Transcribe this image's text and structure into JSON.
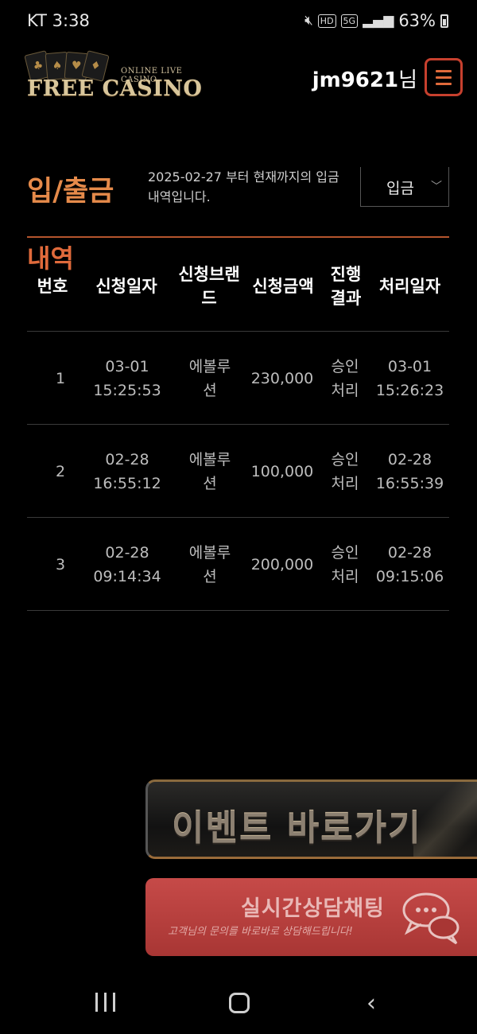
{
  "status_bar": {
    "carrier_time": "KT 3:38",
    "icons": [
      "mute-icon",
      "hd-icon",
      "5g-icon",
      "signal-icon",
      "battery-icon"
    ],
    "hd_label": "HD",
    "network_label": "5G",
    "battery": "63%"
  },
  "header": {
    "logo_sub": "ONLINE LIVE CASINO",
    "logo_main": "FREE CASINO",
    "logo_suits": [
      "♣",
      "♠",
      "♥",
      "♦"
    ],
    "username": "jm9621",
    "username_suffix": "님"
  },
  "page": {
    "title": "입/출금",
    "period_text": "2025-02-27 부터 현재까지의 입금 내역입니다.",
    "type_select": {
      "value": "입금"
    },
    "section_title": "내역"
  },
  "table": {
    "headers": [
      "번호",
      "신청일자",
      "신청브랜드",
      "신청금액",
      "진행결과",
      "처리일자"
    ],
    "rows": [
      {
        "no": "1",
        "req_date": "03-01",
        "req_time": "15:25:53",
        "brand": "에볼루션",
        "amount": "230,000",
        "status": "승인처리",
        "proc_date": "03-01",
        "proc_time": "15:26:23"
      },
      {
        "no": "2",
        "req_date": "02-28",
        "req_time": "16:55:12",
        "brand": "에볼루션",
        "amount": "100,000",
        "status": "승인처리",
        "proc_date": "02-28",
        "proc_time": "16:55:39"
      },
      {
        "no": "3",
        "req_date": "02-28",
        "req_time": "09:14:34",
        "brand": "에볼루션",
        "amount": "200,000",
        "status": "승인처리",
        "proc_date": "02-28",
        "proc_time": "09:15:06"
      }
    ]
  },
  "floating": {
    "event_label": "이벤트 바로가기",
    "chat_label": "실시간상담채팅",
    "chat_sub": "고객님의 문의를 바로바로 상담해드립니다!"
  },
  "colors": {
    "accent": "#e58a4a",
    "menu_border": "#c7402e",
    "chat_bg": "#c64a48",
    "divider": "#b5552d"
  }
}
